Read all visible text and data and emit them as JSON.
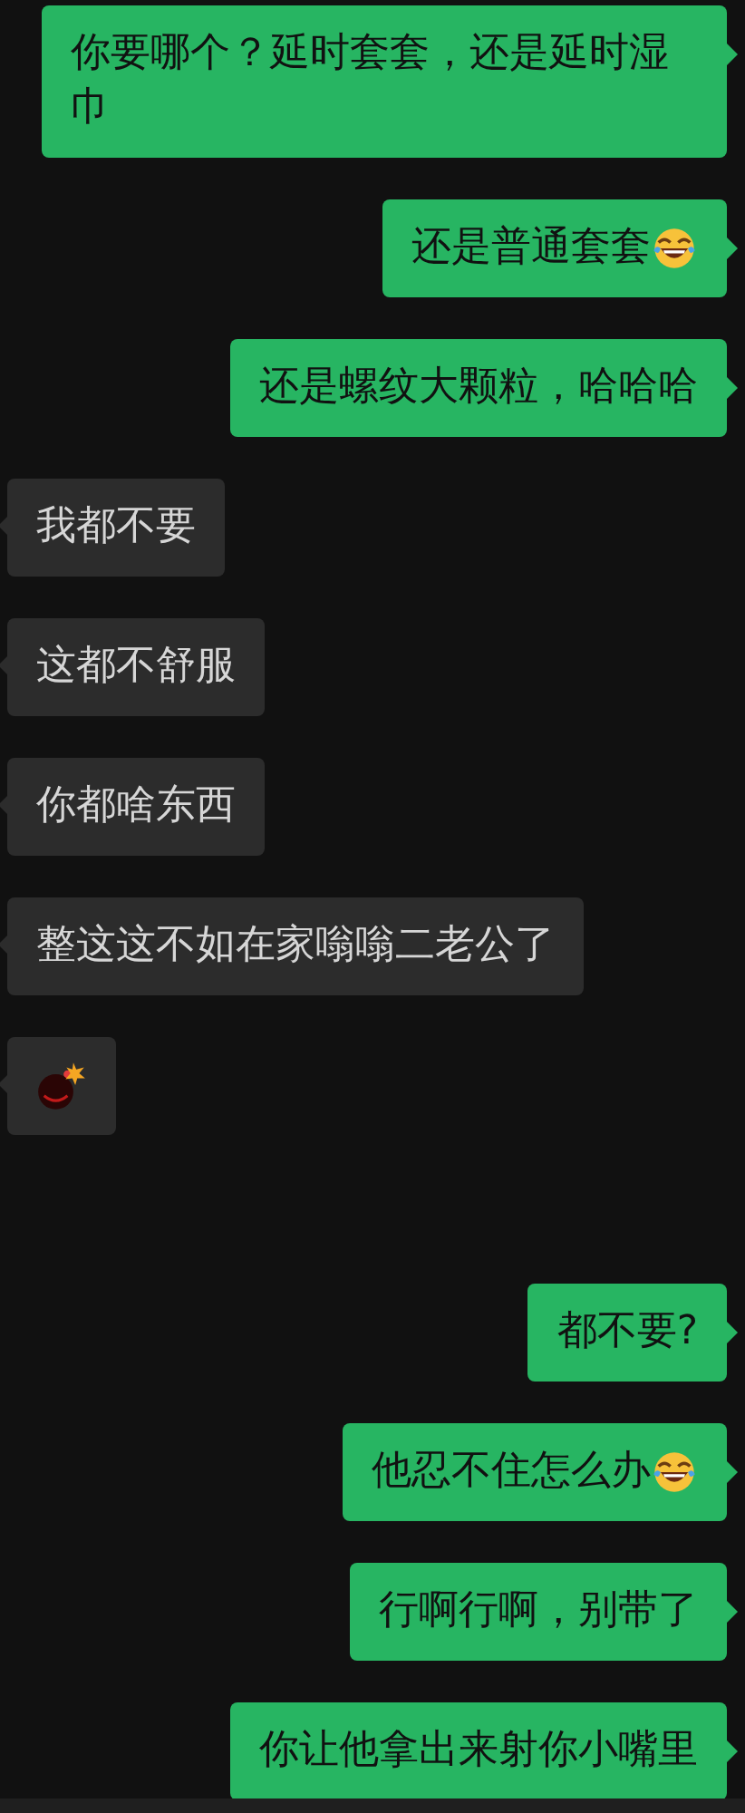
{
  "message_groups": [
    [
      {
        "outgoing": true,
        "kind": "text",
        "text": "你要哪个？延时套套，还是延时湿巾"
      },
      {
        "outgoing": true,
        "kind": "text",
        "text": "还是普通套套",
        "laugh_emoji": true
      },
      {
        "outgoing": true,
        "kind": "text",
        "text": "还是螺纹大颗粒，哈哈哈"
      },
      {
        "outgoing": false,
        "kind": "text",
        "text": "我都不要"
      },
      {
        "outgoing": false,
        "kind": "text",
        "text": "这都不舒服"
      },
      {
        "outgoing": false,
        "kind": "text",
        "text": "你都啥东西"
      },
      {
        "outgoing": false,
        "kind": "text",
        "text": "整这这不如在家嗡嗡二老公了"
      },
      {
        "outgoing": false,
        "kind": "sticker"
      }
    ],
    [
      {
        "outgoing": true,
        "kind": "text",
        "text": "都不要?"
      },
      {
        "outgoing": true,
        "kind": "text",
        "text": "他忍不住怎么办",
        "laugh_emoji": true
      },
      {
        "outgoing": true,
        "kind": "text",
        "text": "行啊行啊，别带了"
      },
      {
        "outgoing": true,
        "kind": "text",
        "text": "你让他拿出来射你小嘴里"
      }
    ]
  ]
}
